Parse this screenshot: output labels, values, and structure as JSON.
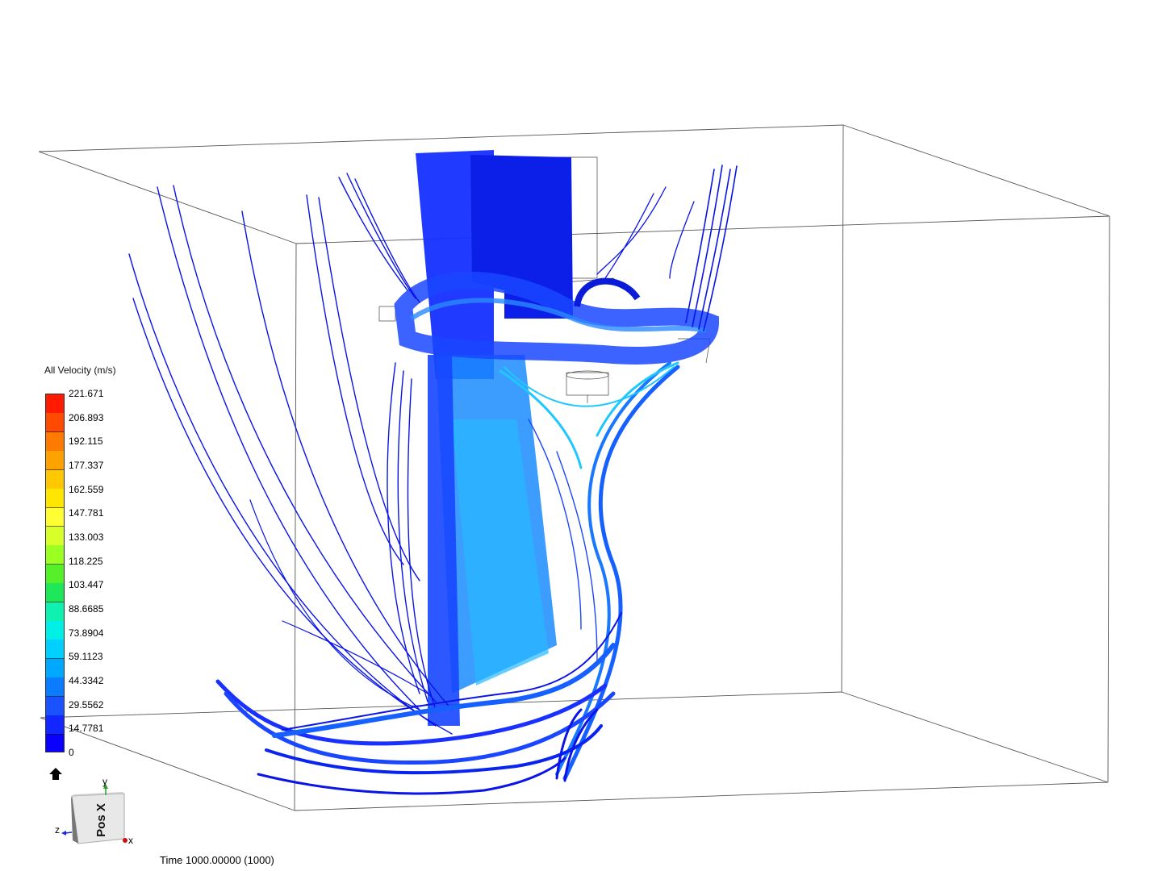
{
  "legend": {
    "title": "All Velocity (m/s)",
    "ticks": [
      "221.671",
      "206.893",
      "192.115",
      "177.337",
      "162.559",
      "147.781",
      "133.003",
      "118.225",
      "103.447",
      "88.6685",
      "73.8904",
      "59.1123",
      "44.3342",
      "29.5562",
      "14.7781",
      "0"
    ],
    "colors": [
      "#ff1a00",
      "#ff4a00",
      "#ff7a00",
      "#ffa200",
      "#ffc800",
      "#ffe600",
      "#ffff33",
      "#d8ff2a",
      "#9cff22",
      "#55f02a",
      "#1ee85a",
      "#10f0b0",
      "#00f0e6",
      "#00cfff",
      "#00a8ff",
      "#0a7cff",
      "#1b52ff",
      "#1226ff",
      "#0a00ff"
    ]
  },
  "viewcube": {
    "face_label": "Pos X",
    "axis_y": "y",
    "axis_z": "z",
    "axis_x": "x"
  },
  "status": {
    "time_text": "Time 1000.00000 (1000)"
  },
  "colors": {
    "streamline_dark": "#0a14e6",
    "streamline_mid": "#1660ff",
    "streamline_light": "#1ec8ff",
    "box_edge": "#333333"
  }
}
